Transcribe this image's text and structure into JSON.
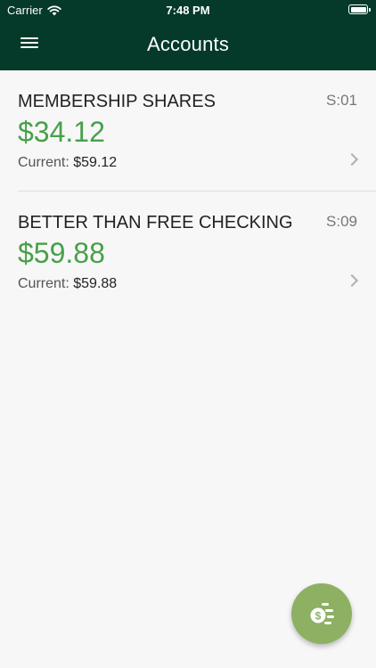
{
  "status_bar": {
    "carrier": "Carrier",
    "time": "7:48 PM"
  },
  "header": {
    "title": "Accounts",
    "menu_icon": "hamburger-menu-icon"
  },
  "accounts": [
    {
      "name": "MEMBERSHIP SHARES",
      "code": "S:01",
      "balance": "$34.12",
      "current_label": "Current:",
      "current_value": "$59.12"
    },
    {
      "name": "BETTER THAN FREE CHECKING",
      "code": "S:09",
      "balance": "$59.88",
      "current_label": "Current:",
      "current_value": "$59.88"
    }
  ],
  "fab": {
    "icon": "money-transfer-icon"
  },
  "colors": {
    "header_background": "#053a2a",
    "balance_green": "#47a04a",
    "fab_background": "#8db063",
    "page_background": "#f7f7f7"
  }
}
